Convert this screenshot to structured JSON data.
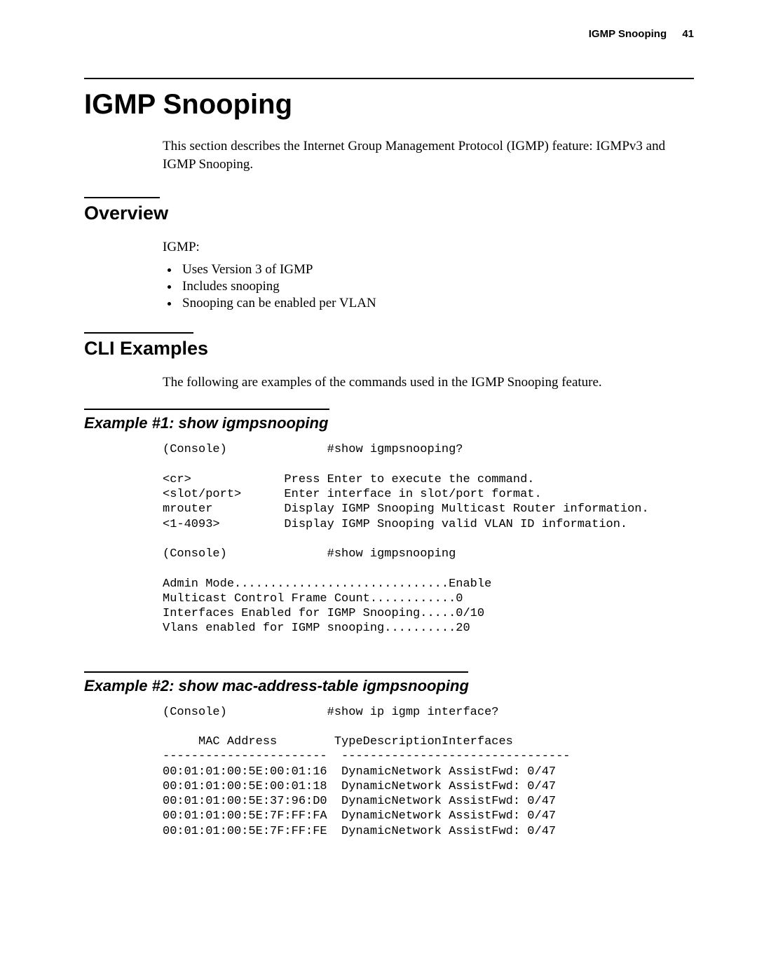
{
  "header": {
    "running_head": "IGMP Snooping",
    "page_number": "41"
  },
  "chapter": {
    "title": "IGMP Snooping",
    "intro": "This section describes the Internet Group Management Protocol (IGMP) feature: IGMPv3 and IGMP Snooping."
  },
  "overview": {
    "heading": "Overview",
    "lead": "IGMP:",
    "bullets": [
      "Uses Version 3 of IGMP",
      "Includes snooping",
      "Snooping can be enabled per VLAN"
    ]
  },
  "cli": {
    "heading": "CLI Examples",
    "intro": "The following are examples of the commands used in the IGMP Snooping feature."
  },
  "example1": {
    "heading": "Example #1: show igmpsnooping",
    "code": "(Console)              #show igmpsnooping?\n\n<cr>             Press Enter to execute the command.\n<slot/port>      Enter interface in slot/port format.\nmrouter          Display IGMP Snooping Multicast Router information.\n<1-4093>         Display IGMP Snooping valid VLAN ID information.\n\n(Console)              #show igmpsnooping\n\nAdmin Mode..............................Enable\nMulticast Control Frame Count............0\nInterfaces Enabled for IGMP Snooping.....0/10\nVlans enabled for IGMP snooping..........20"
  },
  "example2": {
    "heading": "Example #2: show mac-address-table igmpsnooping",
    "code": "(Console)              #show ip igmp interface?\n\n     MAC Address        TypeDescriptionInterfaces\n-----------------------  --------------------------------\n00:01:01:00:5E:00:01:16  DynamicNetwork AssistFwd: 0/47\n00:01:01:00:5E:00:01:18  DynamicNetwork AssistFwd: 0/47\n00:01:01:00:5E:37:96:D0  DynamicNetwork AssistFwd: 0/47\n00:01:01:00:5E:7F:FF:FA  DynamicNetwork AssistFwd: 0/47\n00:01:01:00:5E:7F:FF:FE  DynamicNetwork AssistFwd: 0/47"
  }
}
